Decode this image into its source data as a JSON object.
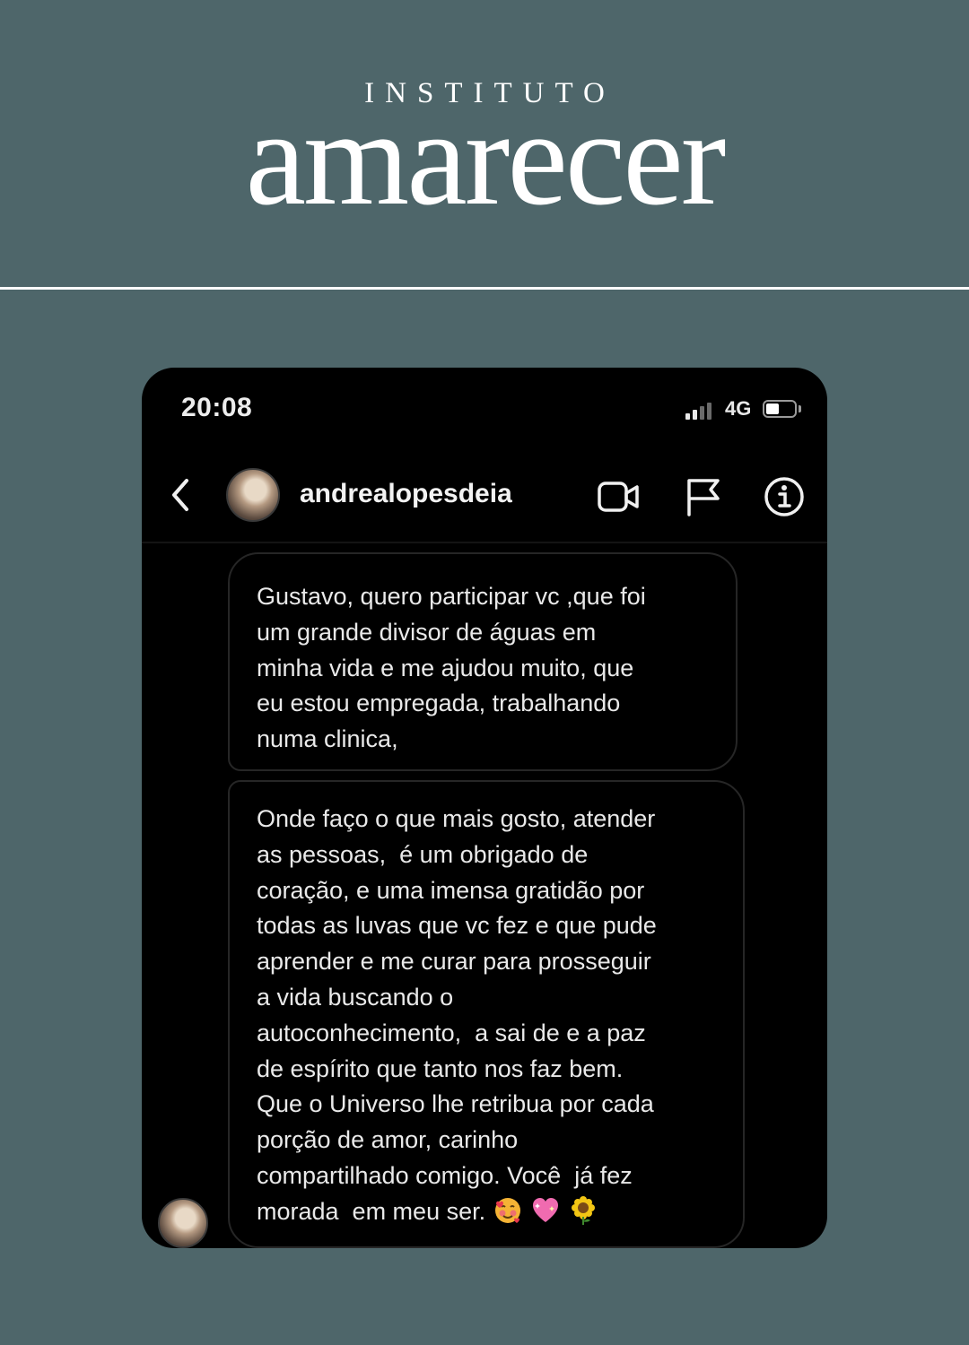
{
  "brand": {
    "top": "INSTITUTO",
    "main": "amarecer"
  },
  "status_bar": {
    "time": "20:08",
    "network": "4G",
    "battery_level": 0.45
  },
  "chat_header": {
    "username": "andrealopesdeia",
    "back_icon": "chevron-left-icon",
    "video_icon": "video-camera-icon",
    "flag_icon": "flag-icon",
    "info_icon": "info-icon"
  },
  "messages": [
    {
      "lines": [
        "Gustavo, quero participar vc ,que foi",
        "um grande divisor de águas em",
        "minha vida e me ajudou muito, que",
        "eu estou empregada, trabalhando",
        "numa clinica,"
      ]
    },
    {
      "lines": [
        "Onde faço o que mais gosto, atender",
        "as pessoas,  é um obrigado de",
        "coração, e uma imensa gratidão por",
        "todas as luvas que vc fez e que pude",
        "aprender e me curar para prosseguir",
        "a vida buscando o",
        "autoconhecimento,  a sai de e a paz",
        "de espírito que tanto nos faz bem.",
        "Que o Universo lhe retribua por cada",
        "porção de amor, carinho",
        "compartilhado comigo. Você  já fez"
      ],
      "last_line": "morada  em meu ser.",
      "emojis": [
        "smiling-face-with-hearts-emoji",
        "sparkling-heart-emoji",
        "sunflower-emoji"
      ]
    }
  ],
  "colors": {
    "background": "#4e666a",
    "phone": "#000000",
    "text": "#e9e9e9",
    "bubble_border": "#262626"
  }
}
